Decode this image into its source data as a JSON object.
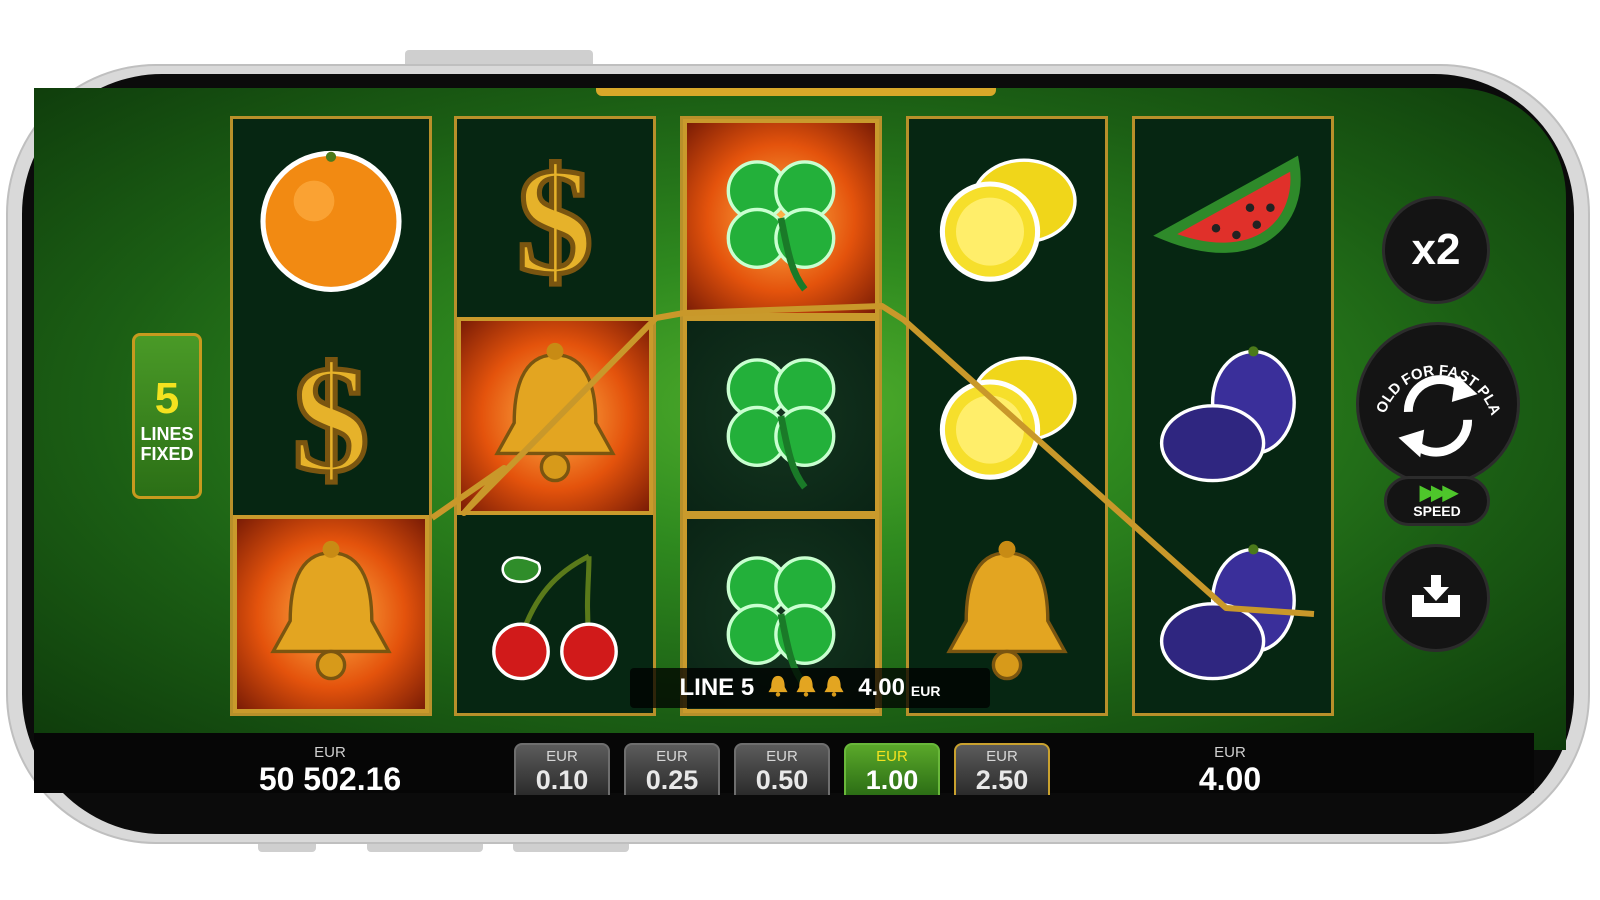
{
  "lines_badge": {
    "number": "5",
    "line1": "LINES",
    "line2": "FIXED"
  },
  "reels": [
    [
      "orange",
      "dollar",
      "bell"
    ],
    [
      "dollar",
      "bell",
      "cherry"
    ],
    [
      "clover",
      "clover",
      "clover"
    ],
    [
      "lemon",
      "lemon",
      "bell"
    ],
    [
      "watermelon",
      "plum",
      "plum"
    ]
  ],
  "win": {
    "label": "LINE 5",
    "amount": "4.00",
    "currency": "EUR",
    "symbol_icon": "bell-icon",
    "symbol_count": 3
  },
  "buttons": {
    "multiplier": "x2",
    "spin_hint": "HOLD FOR FAST PLAY",
    "speed": "SPEED"
  },
  "balance": {
    "currency": "EUR",
    "value": "50 502.16"
  },
  "bet_chips": [
    {
      "currency": "EUR",
      "value": "0.10",
      "state": "normal"
    },
    {
      "currency": "EUR",
      "value": "0.25",
      "state": "normal"
    },
    {
      "currency": "EUR",
      "value": "0.50",
      "state": "normal"
    },
    {
      "currency": "EUR",
      "value": "1.00",
      "state": "active"
    },
    {
      "currency": "EUR",
      "value": "2.50",
      "state": "gold"
    }
  ],
  "bet": {
    "currency": "EUR",
    "value": "4.00"
  },
  "colors": {
    "felt": "#2f8a1f",
    "gold": "#c99a2c",
    "active_chip": "#5aa82a"
  }
}
